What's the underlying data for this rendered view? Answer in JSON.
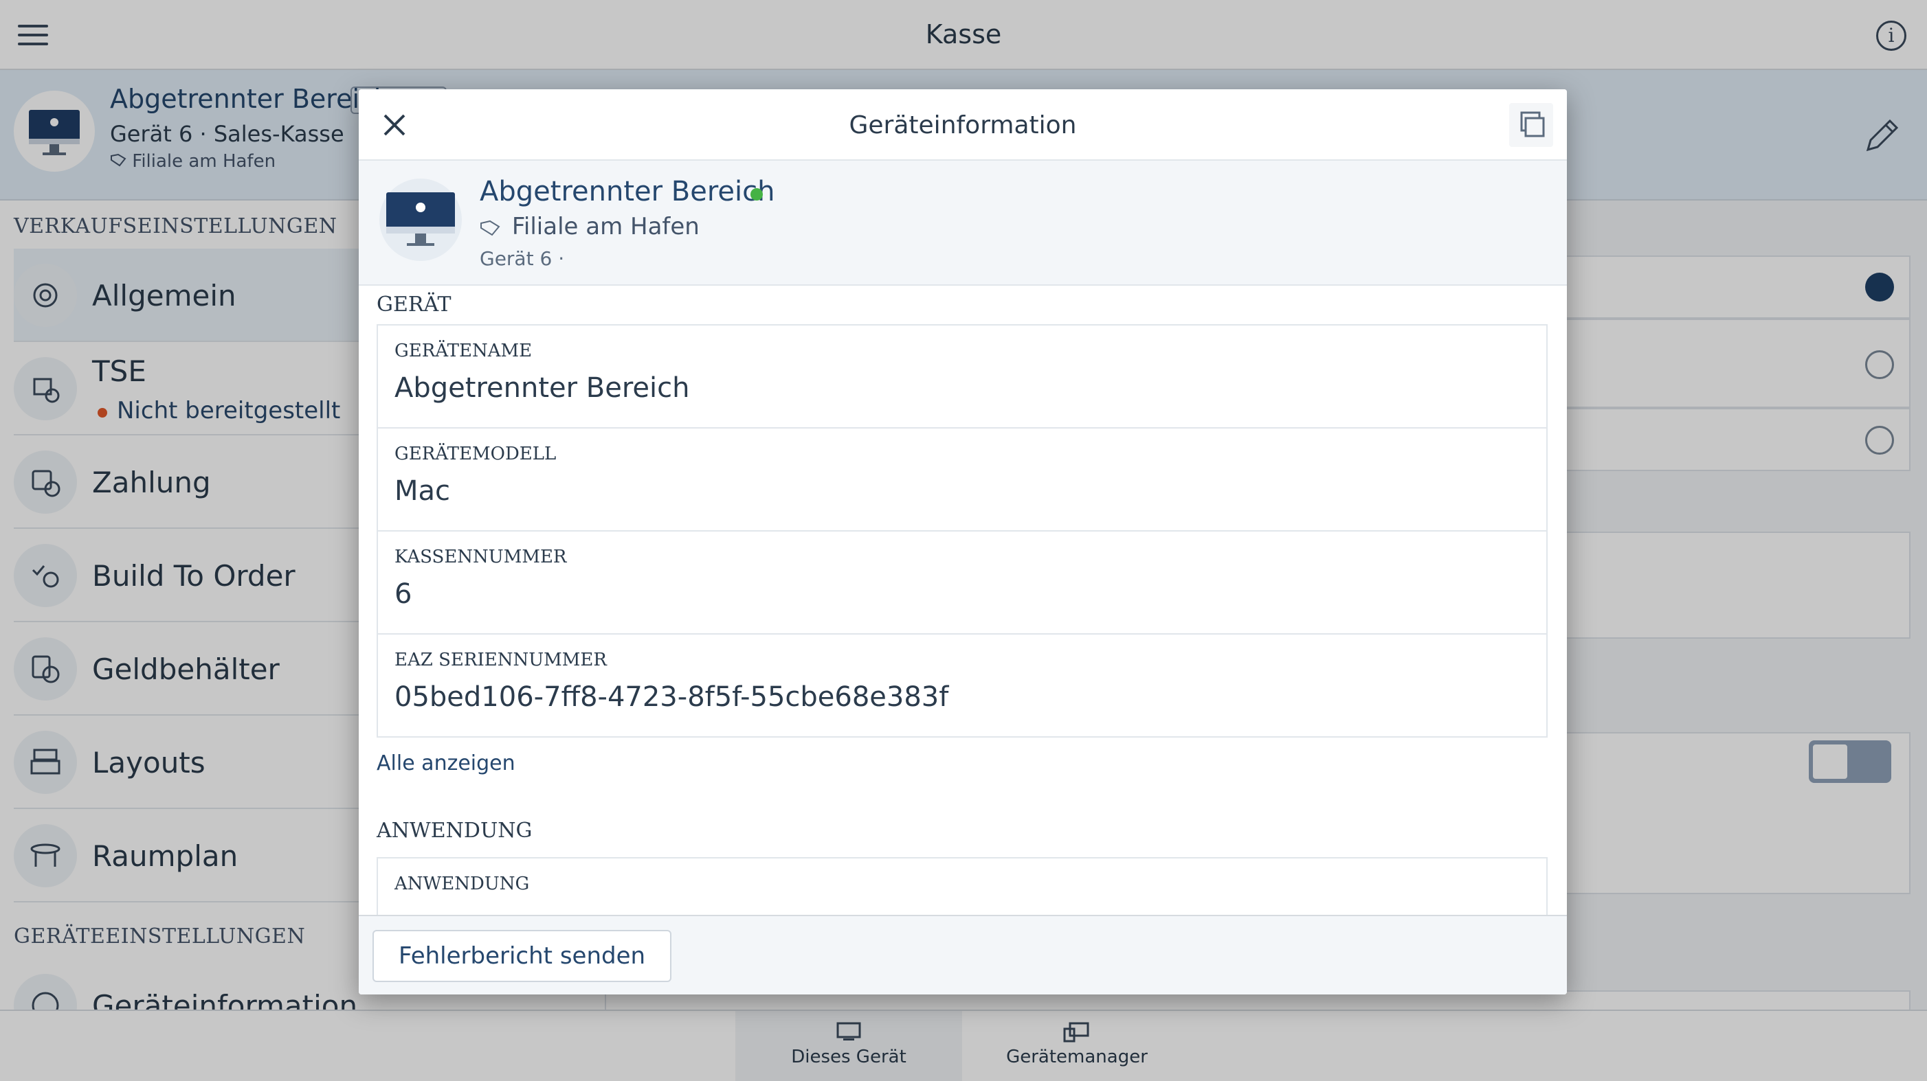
{
  "app": {
    "title": "Kasse"
  },
  "device_header": {
    "name": "Abgetrennter Bereich",
    "subtitle": "Gerät 6 · Sales-Kasse",
    "location": "Filiale am Hafen"
  },
  "sidebar": {
    "section_sales": "VERKAUFSEINSTELLUNGEN",
    "items": [
      {
        "label": "Allgemein",
        "icon": "gear-icon"
      },
      {
        "label": "TSE",
        "sublabel": "Nicht bereitgestellt",
        "icon": "tse-icon"
      },
      {
        "label": "Zahlung",
        "icon": "payment-icon"
      },
      {
        "label": "Build To Order",
        "icon": "build-to-order-icon"
      },
      {
        "label": "Geldbehälter",
        "icon": "cash-drawer-icon"
      },
      {
        "label": "Layouts",
        "icon": "register-layout-icon"
      },
      {
        "label": "Raumplan",
        "icon": "table-plan-icon"
      }
    ],
    "section_device": "GERÄTEEINSTELLUNGEN",
    "partial_item": "Geräteinformation"
  },
  "bottom_tabs": [
    {
      "label": "Dieses Gerät",
      "icon": "this-device-icon"
    },
    {
      "label": "Gerätemanager",
      "icon": "device-manager-icon"
    }
  ],
  "modal": {
    "title": "Geräteinformation",
    "device": {
      "name": "Abgetrennter Bereich",
      "location": "Filiale am Hafen",
      "meta": "Gerät 6 ·",
      "status_color": "#45b245"
    },
    "section_device": "GERÄT",
    "fields": [
      {
        "label": "GERÄTENAME",
        "value": "Abgetrennter Bereich"
      },
      {
        "label": "GERÄTEMODELL",
        "value": "Mac"
      },
      {
        "label": "KASSENNUMMER",
        "value": "6"
      },
      {
        "label": "EAZ SERIENNUMMER",
        "value": "05bed106-7ff8-4723-8f5f-55cbe68e383f"
      }
    ],
    "show_all": "Alle anzeigen",
    "section_app": "ANWENDUNG",
    "app_field_label": "ANWENDUNG",
    "footer_button": "Fehlerbericht senden"
  },
  "colors": {
    "accent": "#25476e",
    "warning": "#e0582a",
    "online": "#45b245"
  }
}
